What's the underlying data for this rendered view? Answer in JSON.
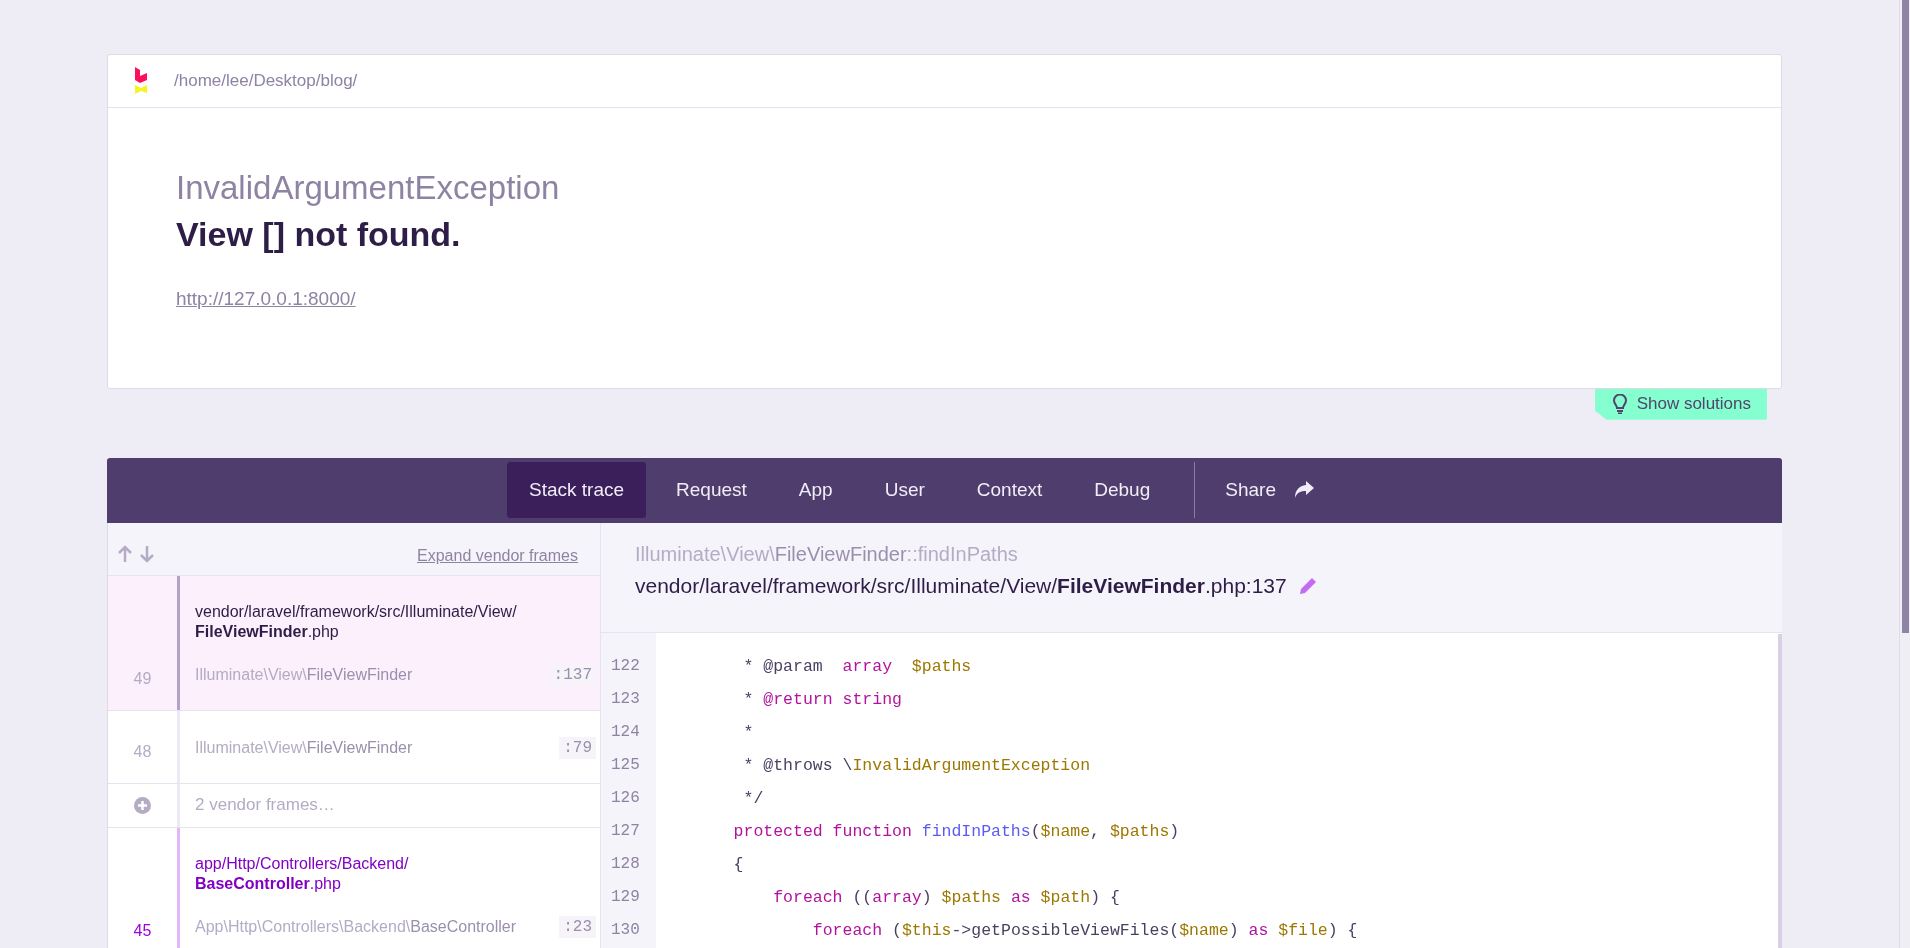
{
  "header": {
    "path": "/home/lee/Desktop/blog/"
  },
  "error": {
    "exception": "InvalidArgumentException",
    "message": "View [] not found.",
    "url": "http://127.0.0.1:8000/"
  },
  "solutions_button": {
    "label": "Show solutions"
  },
  "tabs": [
    {
      "label": "Stack trace",
      "selected": true
    },
    {
      "label": "Request",
      "selected": false
    },
    {
      "label": "App",
      "selected": false
    },
    {
      "label": "User",
      "selected": false
    },
    {
      "label": "Context",
      "selected": false
    },
    {
      "label": "Debug",
      "selected": false
    }
  ],
  "share": {
    "label": "Share"
  },
  "frames_toolbar": {
    "expand_link": "Expand vendor frames"
  },
  "frames": [
    {
      "kind": "frame",
      "number": "49",
      "file_dir": "vendor/laravel/framework/src/Illuminate/View/",
      "file_name": "FileViewFinder",
      "file_ext": ".php",
      "namespace": "Illuminate\\View\\",
      "class": "FileViewFinder",
      "line": ":137",
      "selected": true,
      "app": false
    },
    {
      "kind": "frame",
      "number": "48",
      "namespace": "Illuminate\\View\\",
      "class": "FileViewFinder",
      "line": ":79",
      "selected": false,
      "app": false
    },
    {
      "kind": "collapsed",
      "label": "2 vendor frames…"
    },
    {
      "kind": "frame",
      "number": "45",
      "file_dir": "app/Http/Controllers/Backend/",
      "file_name": "BaseController",
      "file_ext": ".php",
      "namespace": "App\\Http\\Controllers\\Backend\\",
      "class": "BaseController",
      "line": ":23",
      "selected": false,
      "app": true
    }
  ],
  "code_header": {
    "namespace": "Illuminate\\View\\",
    "class": "FileViewFinder",
    "method": "::findInPaths",
    "path": "vendor/laravel/framework/src/Illuminate/View/**FileViewFinder**.php:137"
  },
  "code_lines": [
    {
      "number": "122",
      "tokens": [
        {
          "kind": "plain",
          "text": "     * @param  "
        },
        {
          "kind": "keyword",
          "text": "array  "
        },
        {
          "kind": "variable",
          "text": "$paths"
        }
      ]
    },
    {
      "number": "123",
      "tokens": [
        {
          "kind": "plain",
          "text": "     * "
        },
        {
          "kind": "keyword",
          "text": "@return string"
        }
      ]
    },
    {
      "number": "124",
      "tokens": [
        {
          "kind": "plain",
          "text": "     *"
        }
      ]
    },
    {
      "number": "125",
      "tokens": [
        {
          "kind": "plain",
          "text": "     * @throws \\"
        },
        {
          "kind": "variable",
          "text": "InvalidArgumentException"
        }
      ]
    },
    {
      "number": "126",
      "tokens": [
        {
          "kind": "plain",
          "text": "     */"
        }
      ]
    },
    {
      "number": "127",
      "tokens": [
        {
          "kind": "keyword",
          "text": "    protected function "
        },
        {
          "kind": "function",
          "text": "findInPaths"
        },
        {
          "kind": "plain",
          "text": "("
        },
        {
          "kind": "variable",
          "text": "$name"
        },
        {
          "kind": "plain",
          "text": ", "
        },
        {
          "kind": "variable",
          "text": "$paths"
        },
        {
          "kind": "plain",
          "text": ")"
        }
      ]
    },
    {
      "number": "128",
      "tokens": [
        {
          "kind": "plain",
          "text": "    {"
        }
      ]
    },
    {
      "number": "129",
      "tokens": [
        {
          "kind": "keyword",
          "text": "        foreach"
        },
        {
          "kind": "plain",
          "text": " (("
        },
        {
          "kind": "keyword",
          "text": "array"
        },
        {
          "kind": "plain",
          "text": ") "
        },
        {
          "kind": "variable",
          "text": "$paths "
        },
        {
          "kind": "keyword",
          "text": "as "
        },
        {
          "kind": "variable",
          "text": "$path"
        },
        {
          "kind": "plain",
          "text": ") {"
        }
      ]
    },
    {
      "number": "130",
      "tokens": [
        {
          "kind": "keyword",
          "text": "            foreach"
        },
        {
          "kind": "plain",
          "text": " ("
        },
        {
          "kind": "variable",
          "text": "$this"
        },
        {
          "kind": "plain",
          "text": "->getPossibleViewFiles("
        },
        {
          "kind": "variable",
          "text": "$name"
        },
        {
          "kind": "plain",
          "text": ") "
        },
        {
          "kind": "keyword",
          "text": "as "
        },
        {
          "kind": "variable",
          "text": "$file"
        },
        {
          "kind": "plain",
          "text": ") {"
        }
      ]
    }
  ]
}
